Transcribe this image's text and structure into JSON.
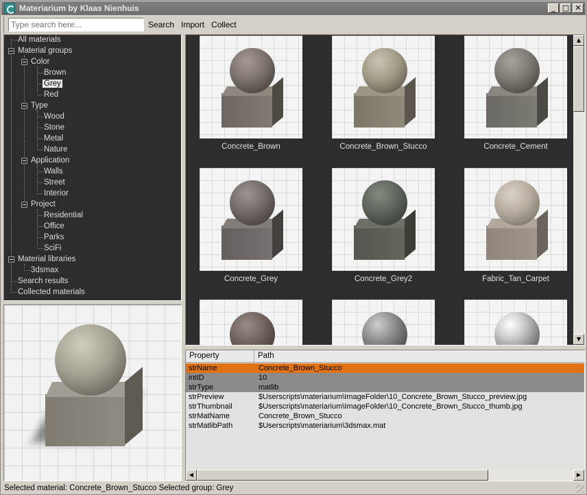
{
  "window": {
    "title": "Materiarium by Klaas Nienhuis"
  },
  "toolbar": {
    "search_placeholder": "Type search here...",
    "search_label": "Search",
    "import_label": "Import",
    "collect_label": "Collect"
  },
  "tree": {
    "all_materials": "All materials",
    "material_groups": "Material groups",
    "color": "Color",
    "brown": "Brown",
    "grey": "Grey",
    "red": "Red",
    "type": "Type",
    "wood": "Wood",
    "stone": "Stone",
    "metal": "Metal",
    "nature": "Nature",
    "application": "Application",
    "walls": "Walls",
    "street": "Street",
    "interior": "Interior",
    "project": "Project",
    "residential": "Residential",
    "office": "Office",
    "parks": "Parks",
    "scifi": "SciFi",
    "material_libraries": "Material libraries",
    "lib_3dsmax": "3dsmax",
    "search_results": "Search results",
    "collected_materials": "Collected materials"
  },
  "thumbnails": [
    {
      "label": "Concrete_Brown"
    },
    {
      "label": "Concrete_Brown_Stucco"
    },
    {
      "label": "Concrete_Cement"
    },
    {
      "label": "Concrete_Grey"
    },
    {
      "label": "Concrete_Grey2"
    },
    {
      "label": "Fabric_Tan_Carpet"
    }
  ],
  "properties": {
    "col_property": "Property",
    "col_path": "Path",
    "rows": [
      {
        "property": "strName",
        "path": "Concrete_Brown_Stucco"
      },
      {
        "property": "intID",
        "path": "10"
      },
      {
        "property": "strType",
        "path": "matlib"
      },
      {
        "property": "strPreview",
        "path": "$Userscripts\\materiarium\\ImageFolder\\10_Concrete_Brown_Stucco_preview.jpg"
      },
      {
        "property": "strThumbnail",
        "path": "$Userscripts\\materiarium\\ImageFolder\\10_Concrete_Brown_Stucco_thumb.jpg"
      },
      {
        "property": "strMatName",
        "path": "Concrete_Brown_Stucco"
      },
      {
        "property": "strMatlibPath",
        "path": "$Userscripts\\materiarium\\3dsmax.mat"
      }
    ]
  },
  "status": {
    "text": "Selected material: Concrete_Brown_Stucco  Selected group: Grey"
  },
  "colors": {
    "selection_orange": "#e07316",
    "panel_dark": "#2d2d2d",
    "titlebar": "#7a7a7a"
  }
}
